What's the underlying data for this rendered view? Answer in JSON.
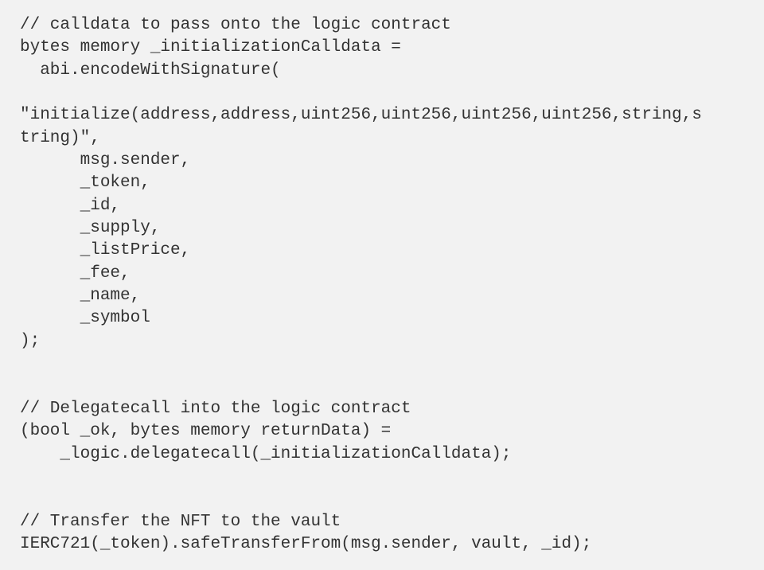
{
  "lines": {
    "l1": "// calldata to pass onto the logic contract",
    "l2": "bytes memory _initializationCalldata =",
    "l3": "  abi.encodeWithSignature(",
    "l4": "",
    "l5": "\"initialize(address,address,uint256,uint256,uint256,uint256,string,s",
    "l6": "tring)\",",
    "l7": "      msg.sender,",
    "l8": "      _token,",
    "l9": "      _id,",
    "l10": "      _supply,",
    "l11": "      _listPrice,",
    "l12": "      _fee,",
    "l13": "      _name,",
    "l14": "      _symbol",
    "l15": ");",
    "l16": "",
    "l17": "",
    "l18": "// Delegatecall into the logic contract",
    "l19": "(bool _ok, bytes memory returnData) =",
    "l20": "    _logic.delegatecall(_initializationCalldata);",
    "l21": "",
    "l22": "",
    "l23": "// Transfer the NFT to the vault",
    "l24": "IERC721(_token).safeTransferFrom(msg.sender, vault, _id);"
  }
}
